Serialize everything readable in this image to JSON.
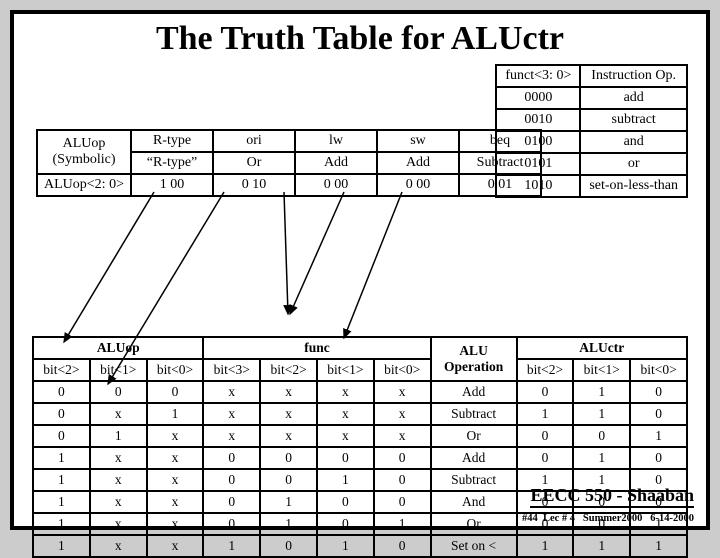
{
  "title": "The Truth Table for ALUctr",
  "t1": {
    "h1": "funct<3: 0>",
    "h2": "Instruction Op.",
    "rows": [
      [
        "0000",
        "add"
      ],
      [
        "0010",
        "subtract"
      ],
      [
        "0100",
        "and"
      ],
      [
        "0101",
        "or"
      ],
      [
        "1010",
        "set-on-less-than"
      ]
    ]
  },
  "t2": {
    "left": {
      "h1": "ALUop (Symbolic)",
      "h2": "ALUop<2: 0>",
      "cols": [
        "R-type",
        "ori",
        "lw",
        "sw",
        "beq"
      ],
      "r1": [
        "“R-type”",
        "Or",
        "Add",
        "Add",
        "Subtract"
      ],
      "r2": [
        "1 00",
        "0 10",
        "0 00",
        "0 00",
        "0 01"
      ]
    }
  },
  "t4": {
    "sect1": "ALUop",
    "sect2": "func",
    "sect3": "ALU Operation",
    "sect4": "ALUctr",
    "cols": [
      "bit<2>",
      "bit<1>",
      "bit<0>",
      "bit<3>",
      "bit<2>",
      "bit<1>",
      "bit<0>",
      "",
      "bit<2>",
      "bit<1>",
      "bit<0>"
    ],
    "rows": [
      [
        "0",
        "0",
        "0",
        "x",
        "x",
        "x",
        "x",
        "Add",
        "0",
        "1",
        "0"
      ],
      [
        "0",
        "x",
        "1",
        "x",
        "x",
        "x",
        "x",
        "Subtract",
        "1",
        "1",
        "0"
      ],
      [
        "0",
        "1",
        "x",
        "x",
        "x",
        "x",
        "x",
        "Or",
        "0",
        "0",
        "1"
      ],
      [
        "1",
        "x",
        "x",
        "0",
        "0",
        "0",
        "0",
        "Add",
        "0",
        "1",
        "0"
      ],
      [
        "1",
        "x",
        "x",
        "0",
        "0",
        "1",
        "0",
        "Subtract",
        "1",
        "1",
        "0"
      ],
      [
        "1",
        "x",
        "x",
        "0",
        "1",
        "0",
        "0",
        "And",
        "0",
        "0",
        "0"
      ],
      [
        "1",
        "x",
        "x",
        "0",
        "1",
        "0",
        "1",
        "Or",
        "0",
        "0",
        "1"
      ],
      [
        "1",
        "x",
        "x",
        "1",
        "0",
        "1",
        "0",
        "Set on <",
        "1",
        "1",
        "1"
      ]
    ]
  },
  "footer1": "EECC 550 - Shaaban",
  "footer2": "#44  Lec # 4   Summer2000   6-14-2000"
}
